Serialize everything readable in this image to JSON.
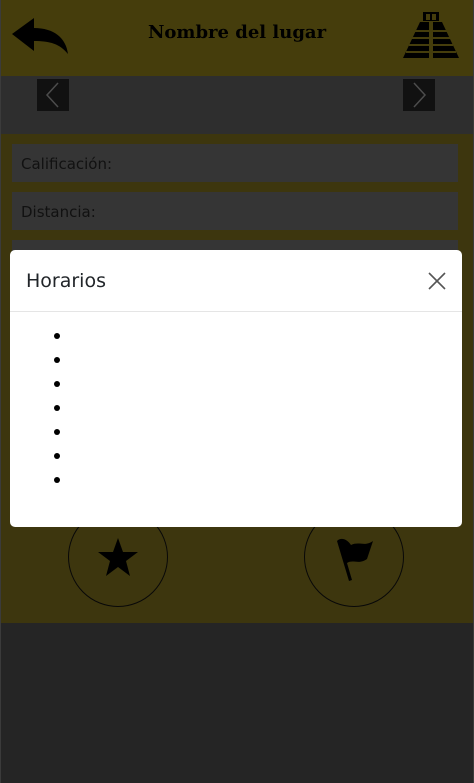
{
  "header": {
    "title": "Nombre del lugar",
    "back_icon": "back-arrow-icon",
    "logo_icon": "pyramid-icon"
  },
  "carousel": {
    "prev_icon": "chevron-left-icon",
    "next_icon": "chevron-right-icon"
  },
  "fields": {
    "rating_label": "Calificación:",
    "distance_label": "Distancia:"
  },
  "actions": {
    "favorite_icon": "star-icon",
    "flag_icon": "flag-icon"
  },
  "modal": {
    "title": "Horarios",
    "close_icon": "close-icon",
    "hours": [
      "",
      "",
      "",
      "",
      "",
      "",
      ""
    ]
  },
  "colors": {
    "header": "#8a7a18",
    "accent": "#7a6c1c",
    "modal_bg": "#ffffff"
  }
}
